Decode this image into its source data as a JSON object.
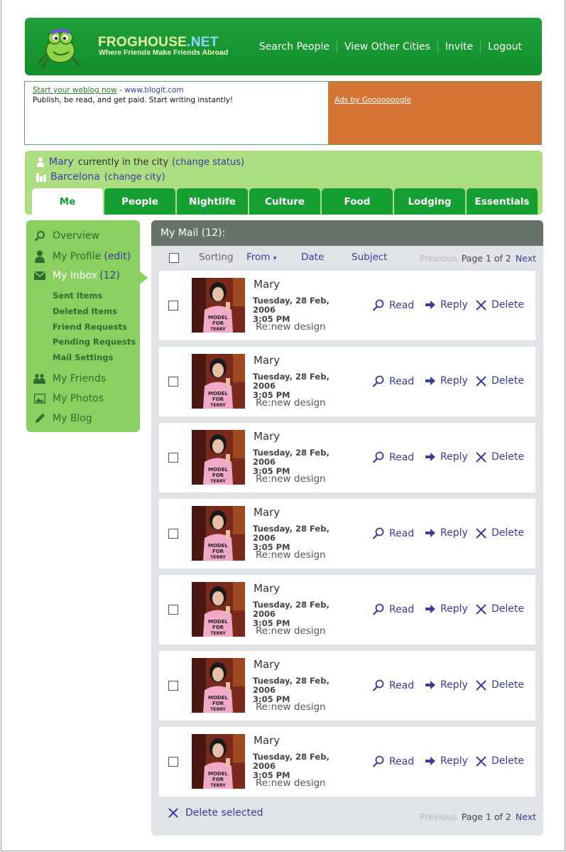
{
  "header": {
    "brand_main": "FROGHOUSE",
    "brand_net": ".NET",
    "tagline": "Where Friends Make Friends Abroad",
    "nav": [
      "Search People",
      "View Other Cities",
      "Invite",
      "Logout"
    ]
  },
  "ad": {
    "link_text": "Start your weblog now",
    "dash": " - ",
    "url": "www.blogit.com",
    "body": "Publish, be read, and get paid. Start writing instantly!",
    "ads_by": "Ads by Gooooooogle"
  },
  "status": {
    "user": "Mary",
    "line1_text": "currently in the city",
    "change_status": "(change status)",
    "city": "Barcelona",
    "change_city": "(change city)"
  },
  "tabs": [
    "Me",
    "People",
    "Nightlife",
    "Culture",
    "Food",
    "Lodging",
    "Essentials"
  ],
  "sidebar": {
    "overview": "Overview",
    "profile": "My Profile",
    "edit": "(edit)",
    "inbox": "My Inbox",
    "inbox_count": "(12)",
    "sub": [
      "Sent Items",
      "Deleted Items",
      "Friend Requests",
      "Pending Requests",
      "Mail Settings"
    ],
    "friends": "My Friends",
    "photos": "My Photos",
    "blog": "My Blog"
  },
  "mail": {
    "title": "My Mail (12):",
    "sorting": "Sorting",
    "from": "From",
    "date": "Date",
    "subject": "Subject",
    "previous": "Previous",
    "page": "Page 1 of 2",
    "next": "Next",
    "read": "Read",
    "reply": "Reply",
    "delete": "Delete",
    "delete_selected": "Delete selected",
    "messages": [
      {
        "from": "Mary",
        "date": "Tuesday, 28 Feb, 2006",
        "time": "3:05 PM",
        "subject": "Re:new design"
      },
      {
        "from": "Mary",
        "date": "Tuesday, 28 Feb, 2006",
        "time": "3:05 PM",
        "subject": "Re:new design"
      },
      {
        "from": "Mary",
        "date": "Tuesday, 28 Feb, 2006",
        "time": "3:05 PM",
        "subject": "Re:new design"
      },
      {
        "from": "Mary",
        "date": "Tuesday, 28 Feb, 2006",
        "time": "3:05 PM",
        "subject": "Re:new design"
      },
      {
        "from": "Mary",
        "date": "Tuesday, 28 Feb, 2006",
        "time": "3:05 PM",
        "subject": "Re:new design"
      },
      {
        "from": "Mary",
        "date": "Tuesday, 28 Feb, 2006",
        "time": "3:05 PM",
        "subject": "Re:new design"
      },
      {
        "from": "Mary",
        "date": "Tuesday, 28 Feb, 2006",
        "time": "3:05 PM",
        "subject": "Re:new design"
      }
    ]
  },
  "colors": {
    "header_green": "#16a034",
    "status_green": "#aede82",
    "sidebar_green": "#8ad060",
    "ad_orange": "#d47436",
    "link_purple": "#3a3a9a",
    "panel_head": "#65736a"
  }
}
